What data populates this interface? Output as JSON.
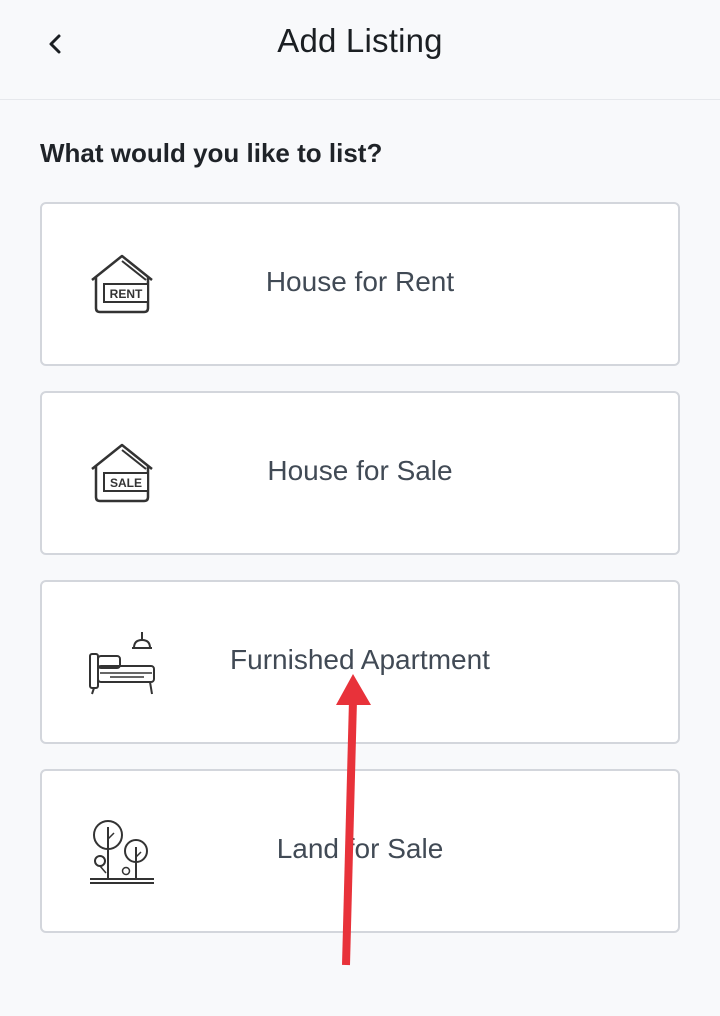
{
  "header": {
    "title": "Add Listing",
    "back_icon": "chevron-left-icon"
  },
  "question": "What would you like to list?",
  "options": [
    {
      "label": "House for Rent",
      "icon": "house-rent-icon",
      "icon_text": "RENT"
    },
    {
      "label": "House for Sale",
      "icon": "house-sale-icon",
      "icon_text": "SALE"
    },
    {
      "label": "Furnished Apartment",
      "icon": "furnished-apartment-icon"
    },
    {
      "label": "Land for Sale",
      "icon": "land-trees-icon"
    }
  ],
  "annotation": {
    "type": "arrow",
    "color": "#e8323a"
  }
}
